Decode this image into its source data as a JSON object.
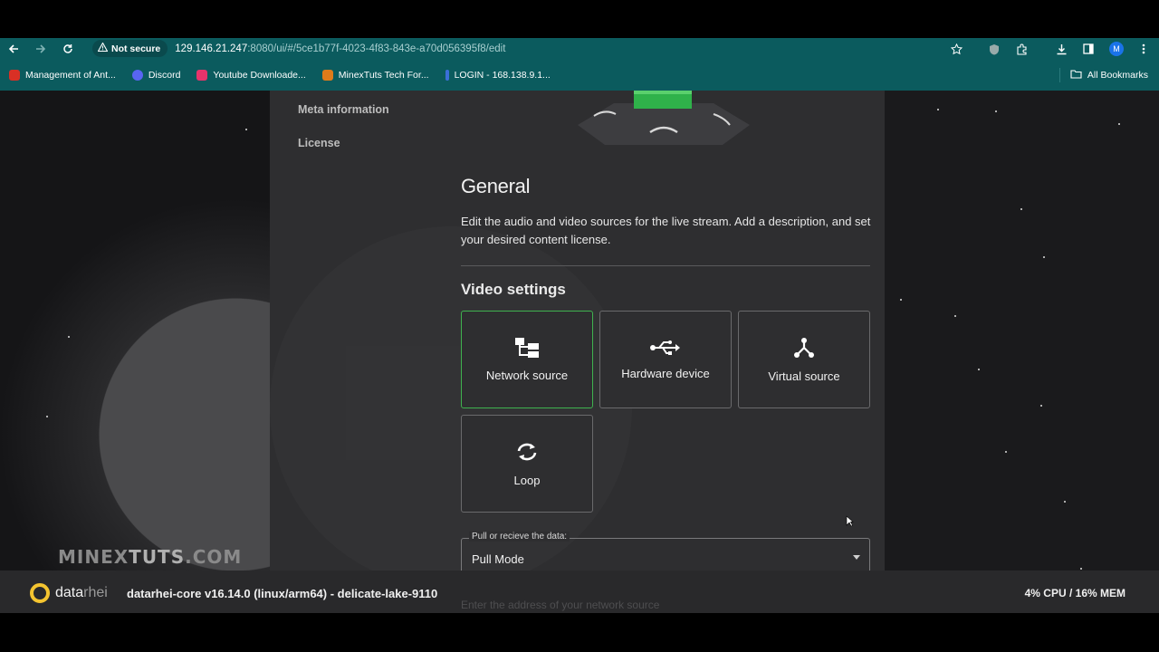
{
  "browser": {
    "security_label": "Not secure",
    "url_host": "129.146.21.247",
    "url_rest": ":8080/ui/#/5ce1b77f-4023-4f83-843e-a70d056395f8/edit",
    "profile_initial": "M"
  },
  "bookmarks": {
    "items": [
      {
        "label": "Management of Ant...",
        "icon": "bookmark-icon",
        "color": "#d93025"
      },
      {
        "label": "Discord",
        "icon": "discord-icon",
        "color": "#5865f2"
      },
      {
        "label": "Youtube Downloade...",
        "icon": "download-icon",
        "color": "#e8336b"
      },
      {
        "label": "MinexTuts Tech For...",
        "icon": "forum-icon",
        "color": "#e07b1a"
      },
      {
        "label": "LOGIN - 168.138.9.1...",
        "icon": "login-icon",
        "color": "#3b6fd8"
      }
    ],
    "all_label": "All Bookmarks"
  },
  "sidebar": {
    "meta_label": "Meta information",
    "license_label": "License"
  },
  "main": {
    "heading": "General",
    "description": "Edit the audio and video sources for the live stream. Add a description, and set your desired content license.",
    "video_heading": "Video settings",
    "sources": [
      {
        "label": "Network source",
        "icon": "network-icon",
        "active": true
      },
      {
        "label": "Hardware device",
        "icon": "usb-icon",
        "active": false
      },
      {
        "label": "Virtual source",
        "icon": "virtual-icon",
        "active": false
      },
      {
        "label": "Loop",
        "icon": "loop-icon",
        "active": false
      }
    ],
    "mode_field": {
      "label": "Pull or recieve the data:",
      "value": "Pull Mode"
    },
    "hint": "Enter the address of your network source"
  },
  "watermark": {
    "left": "MINEX",
    "mid": "TUTS",
    "right": ".COM"
  },
  "footer": {
    "brand_data": "data",
    "brand_rhei": "rhei",
    "version": "datarhei-core v16.14.0 (linux/arm64) - delicate-lake-9110",
    "usage": "4% CPU / 16% MEM"
  },
  "colors": {
    "chrome": "#0b5b5e",
    "accent_green": "#3fb24f",
    "brand_yellow": "#f4c430",
    "panel": "#2e2e30"
  }
}
